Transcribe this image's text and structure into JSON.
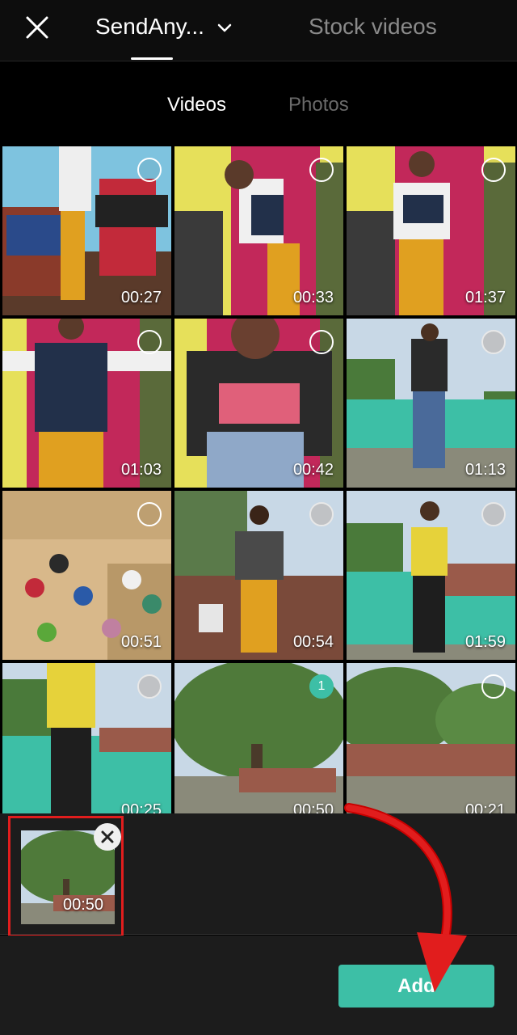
{
  "header": {
    "album_label": "SendAny...",
    "stock_tab_label": "Stock videos"
  },
  "subtabs": {
    "videos_label": "Videos",
    "photos_label": "Photos"
  },
  "grid": {
    "items": [
      {
        "duration": "00:27",
        "selection": "empty"
      },
      {
        "duration": "00:33",
        "selection": "empty"
      },
      {
        "duration": "01:37",
        "selection": "empty"
      },
      {
        "duration": "01:03",
        "selection": "empty"
      },
      {
        "duration": "00:42",
        "selection": "empty"
      },
      {
        "duration": "01:13",
        "selection": "filled"
      },
      {
        "duration": "00:51",
        "selection": "empty"
      },
      {
        "duration": "00:54",
        "selection": "filled"
      },
      {
        "duration": "01:59",
        "selection": "filled"
      },
      {
        "duration": "00:25",
        "selection": "filled"
      },
      {
        "duration": "00:50",
        "selection": "1"
      },
      {
        "duration": "00:21",
        "selection": "empty"
      }
    ]
  },
  "tray": {
    "selected_duration": "00:50"
  },
  "footer": {
    "add_label": "Add"
  },
  "colors": {
    "accent": "#3dbfa6",
    "highlight": "#e11d1d"
  },
  "icons": {
    "close": "close-icon",
    "dropdown": "chevron-down-icon",
    "remove": "remove-icon",
    "annotation": "red-arrow"
  }
}
